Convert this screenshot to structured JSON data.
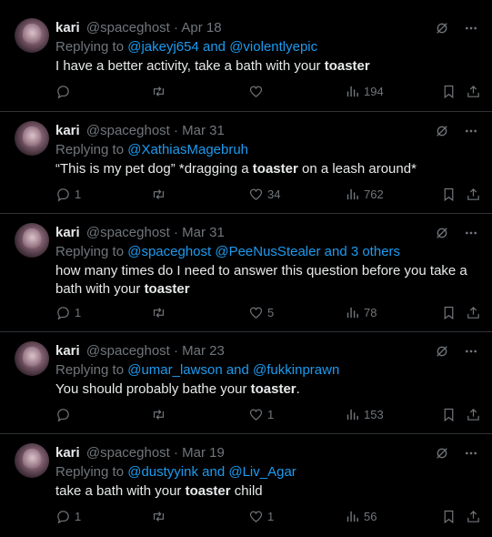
{
  "tweets": [
    {
      "name": "kari",
      "handle": "@spaceghost",
      "date": "Apr 18",
      "replying_prefix": "Replying to ",
      "mention1": "@jakeyj654",
      "joiner": " and ",
      "mention2": "@violentlyepic",
      "suffix": "",
      "text_before": "I have a better activity, take a bath with your ",
      "keyword": "toaster",
      "text_after": "",
      "reply_count": "",
      "retweet_count": "",
      "like_count": "",
      "view_count": "194"
    },
    {
      "name": "kari",
      "handle": "@spaceghost",
      "date": "Mar 31",
      "replying_prefix": "Replying to ",
      "mention1": "@XathiasMagebruh",
      "joiner": "",
      "mention2": "",
      "suffix": "",
      "text_before": "“This is my pet dog” *dragging a ",
      "keyword": "toaster",
      "text_after": " on a leash around*",
      "reply_count": "1",
      "retweet_count": "",
      "like_count": "34",
      "view_count": "762"
    },
    {
      "name": "kari",
      "handle": "@spaceghost",
      "date": "Mar 31",
      "replying_prefix": "Replying to ",
      "mention1": "@spaceghost",
      "joiner": " ",
      "mention2": "@PeeNusStealer",
      "suffix": " and 3 others",
      "text_before": "how many times do I need to answer this question before you take a bath with your ",
      "keyword": "toaster",
      "text_after": "",
      "reply_count": "1",
      "retweet_count": "",
      "like_count": "5",
      "view_count": "78"
    },
    {
      "name": "kari",
      "handle": "@spaceghost",
      "date": "Mar 23",
      "replying_prefix": "Replying to ",
      "mention1": "@umar_lawson",
      "joiner": " and ",
      "mention2": "@fukkinprawn",
      "suffix": "",
      "text_before": "You should probably bathe your ",
      "keyword": "toaster",
      "text_after": ".",
      "reply_count": "",
      "retweet_count": "",
      "like_count": "1",
      "view_count": "153"
    },
    {
      "name": "kari",
      "handle": "@spaceghost",
      "date": "Mar 19",
      "replying_prefix": "Replying to ",
      "mention1": "@dustyyink",
      "joiner": " and ",
      "mention2": "@Liv_Agar",
      "suffix": "",
      "text_before": "take a bath with your ",
      "keyword": "toaster",
      "text_after": " child",
      "reply_count": "1",
      "retweet_count": "",
      "like_count": "1",
      "view_count": "56"
    }
  ],
  "separator": " · ",
  "icons": {
    "grok": "grok-icon",
    "more": "more-icon",
    "reply": "reply-icon",
    "retweet": "retweet-icon",
    "like": "heart-icon",
    "views": "views-icon",
    "bookmark": "bookmark-icon",
    "share": "share-icon"
  },
  "colors": {
    "background": "#000000",
    "text": "#e7e9ea",
    "muted": "#71767b",
    "link": "#1d9bf0",
    "divider": "#2f3336"
  }
}
